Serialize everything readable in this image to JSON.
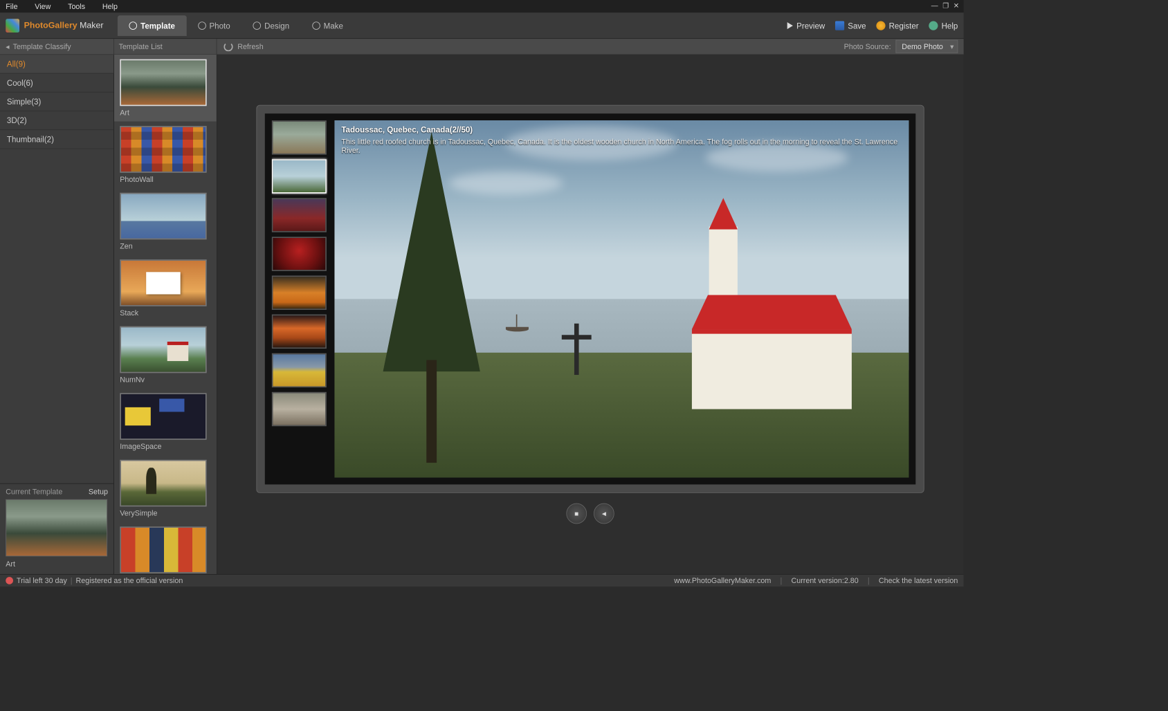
{
  "menubar": {
    "file": "File",
    "view": "View",
    "tools": "Tools",
    "help": "Help"
  },
  "logo": {
    "part1": "PhotoGallery",
    "part2": " Maker"
  },
  "tabs": {
    "template": "Template",
    "photo": "Photo",
    "design": "Design",
    "make": "Make"
  },
  "actions": {
    "preview": "Preview",
    "save": "Save",
    "register": "Register",
    "help": "Help"
  },
  "subbar": {
    "classify": "Template Classify",
    "template_list": "Template List",
    "refresh": "Refresh",
    "photo_source_label": "Photo Source:",
    "photo_source_value": "Demo Photo"
  },
  "classify": {
    "items": [
      {
        "label": "All(9)"
      },
      {
        "label": "Cool(6)"
      },
      {
        "label": "Simple(3)"
      },
      {
        "label": "3D(2)"
      },
      {
        "label": "Thumbnail(2)"
      }
    ]
  },
  "templates": [
    {
      "label": "Art"
    },
    {
      "label": "PhotoWall"
    },
    {
      "label": "Zen"
    },
    {
      "label": "Stack"
    },
    {
      "label": "NumNv"
    },
    {
      "label": "ImageSpace"
    },
    {
      "label": "VerySimple"
    },
    {
      "label": ""
    }
  ],
  "current_template": {
    "heading": "Current Template",
    "setup": "Setup",
    "name": "Art"
  },
  "preview": {
    "title": "Tadoussac, Quebec, Canada(2//50)",
    "desc": "This little red roofed church is in Tadoussac, Quebec, Canada. It is the oldest wooden church in North America. The fog rolls out in the morning to reveal the St. Lawrence River."
  },
  "controls": {
    "stop": "■",
    "sound": "◄"
  },
  "status": {
    "trial": "Trial left 30 day",
    "registered": "Registered as the official version",
    "site": "www.PhotoGalleryMaker.com",
    "version": "Current version:2.80",
    "check": "Check the latest version"
  }
}
